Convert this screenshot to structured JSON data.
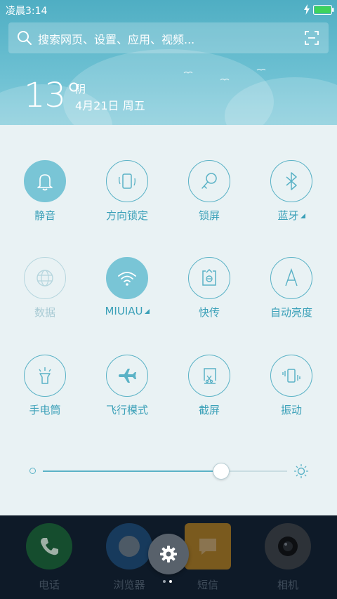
{
  "status_bar": {
    "time": "凌晨3:14"
  },
  "search": {
    "placeholder": "搜索网页、设置、应用、视频..."
  },
  "weather": {
    "temperature": "13°",
    "condition": "阴",
    "date": "4月21日 周五"
  },
  "toggles": [
    {
      "label": "静音",
      "state": "on"
    },
    {
      "label": "方向锁定",
      "state": "off_default"
    },
    {
      "label": "锁屏",
      "state": "off_default"
    },
    {
      "label": "蓝牙",
      "state": "off_default",
      "has_more": true
    },
    {
      "label": "数据",
      "state": "disabled"
    },
    {
      "label": "MIUIAU",
      "state": "on",
      "has_more": true
    },
    {
      "label": "快传",
      "state": "off_default"
    },
    {
      "label": "自动亮度",
      "state": "off_default"
    },
    {
      "label": "手电筒",
      "state": "off_default"
    },
    {
      "label": "飞行模式",
      "state": "off_default"
    },
    {
      "label": "截屏",
      "state": "off_default"
    },
    {
      "label": "振动",
      "state": "off_default"
    }
  ],
  "brightness": {
    "level": 0.73
  },
  "dock": [
    {
      "label": "电话",
      "icon": "phone-icon",
      "color": "#1f7a3e"
    },
    {
      "label": "浏览器",
      "icon": "browser-icon",
      "color": "#1a4a6e"
    },
    {
      "label": "短信",
      "icon": "message-icon",
      "color": "#b07a1e"
    },
    {
      "label": "相机",
      "icon": "camera-icon",
      "color": "#3a3f47"
    }
  ],
  "colors": {
    "accent": "#5ab2c6",
    "accent_fill": "#79c5d6",
    "panel": "#e9f2f4"
  }
}
